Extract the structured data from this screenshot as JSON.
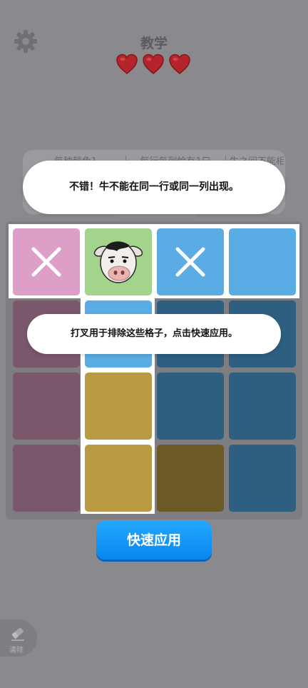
{
  "header": {
    "title": "教学",
    "settings_icon": "gear-icon",
    "lives": 3,
    "heart_icon": "heart-icon"
  },
  "hint_panel": {
    "tabs": [
      "每种颜色1",
      "每行每列恰有1只",
      "牛之间不能相"
    ]
  },
  "popups": {
    "top": "不错！牛不能在同一行或同一列出现。",
    "middle": "打叉用于排除这些格子，点击快速应用。"
  },
  "board": {
    "rows": 4,
    "cols": 4,
    "colors": {
      "pink": "#dd9ec7",
      "green": "#a3d48c",
      "sky": "#5aace4",
      "pink_dim": "#7b576c",
      "sky_dim": "#2f5f80",
      "gold_dim": "#b89a42",
      "olive_dim": "#6b5a26",
      "highlight": "#ffffff"
    },
    "cells": [
      [
        "pink:x",
        "green:cow",
        "sky:x",
        "sky:empty"
      ],
      [
        "pink_dim",
        "sky",
        "sky_dim",
        "sky_dim"
      ],
      [
        "pink_dim",
        "gold_dim",
        "sky_dim",
        "sky_dim"
      ],
      [
        "pink_dim",
        "gold_dim",
        "olive_dim",
        "sky_dim"
      ]
    ],
    "cross_icon": "x-mark-icon",
    "cow_icon": "cow-icon"
  },
  "actions": {
    "apply_label": "快速应用",
    "clear_label": "清除",
    "clear_icon": "eraser-icon"
  }
}
